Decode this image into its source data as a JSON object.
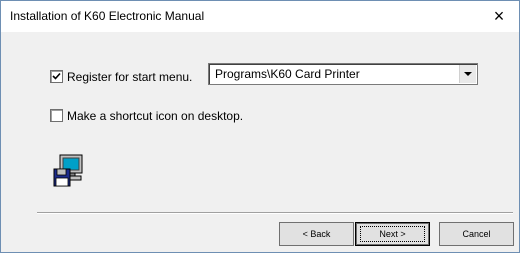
{
  "window": {
    "title": "Installation of K60 Electronic Manual",
    "close_glyph": "×"
  },
  "options": {
    "register_start_menu": {
      "checked": true,
      "label": "Register for start menu."
    },
    "program_folder": {
      "selected": "Programs\\K60 Card Printer"
    },
    "desktop_shortcut": {
      "checked": false,
      "label": "Make a shortcut icon on desktop."
    }
  },
  "icon": {
    "name": "computer-floppy-icon"
  },
  "buttons": {
    "back": "< Back",
    "next": "Next >",
    "cancel": "Cancel"
  }
}
